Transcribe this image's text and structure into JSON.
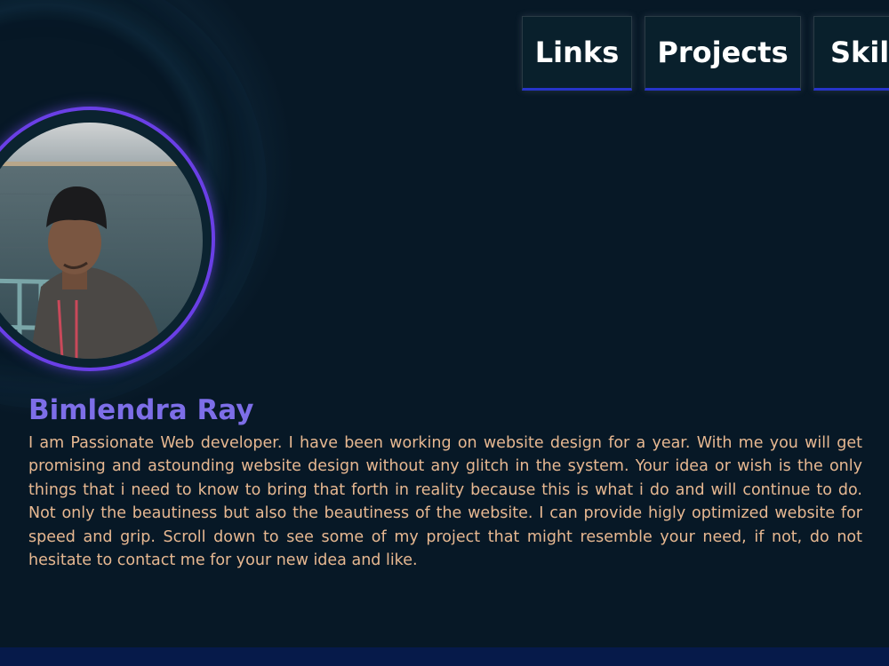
{
  "nav": {
    "items": [
      {
        "label": "Links"
      },
      {
        "label": "Projects"
      },
      {
        "label": "Skills"
      }
    ]
  },
  "profile": {
    "name": "Bimlendra Ray",
    "bio": "I am Passionate Web developer. I have been working on website design for a year. With me you will get promising and astounding website design without any glitch in the system. Your idea or wish is the only things that i need to know to bring that forth in reality because this is what i do and will continue to do. Not only the beautiness but also the beautiness of the website. I can provide higly optimized website for speed and grip. Scroll down to see some of my project that might resemble your need, if not, do not hesitate to contact me for your new idea and like.",
    "avatar": "profile-photo"
  },
  "colors": {
    "background": "#071826",
    "accent": "#6a3fe6",
    "name": "#7d6ee8",
    "bio_text": "#e7b891",
    "nav_border": "#2734c9"
  }
}
